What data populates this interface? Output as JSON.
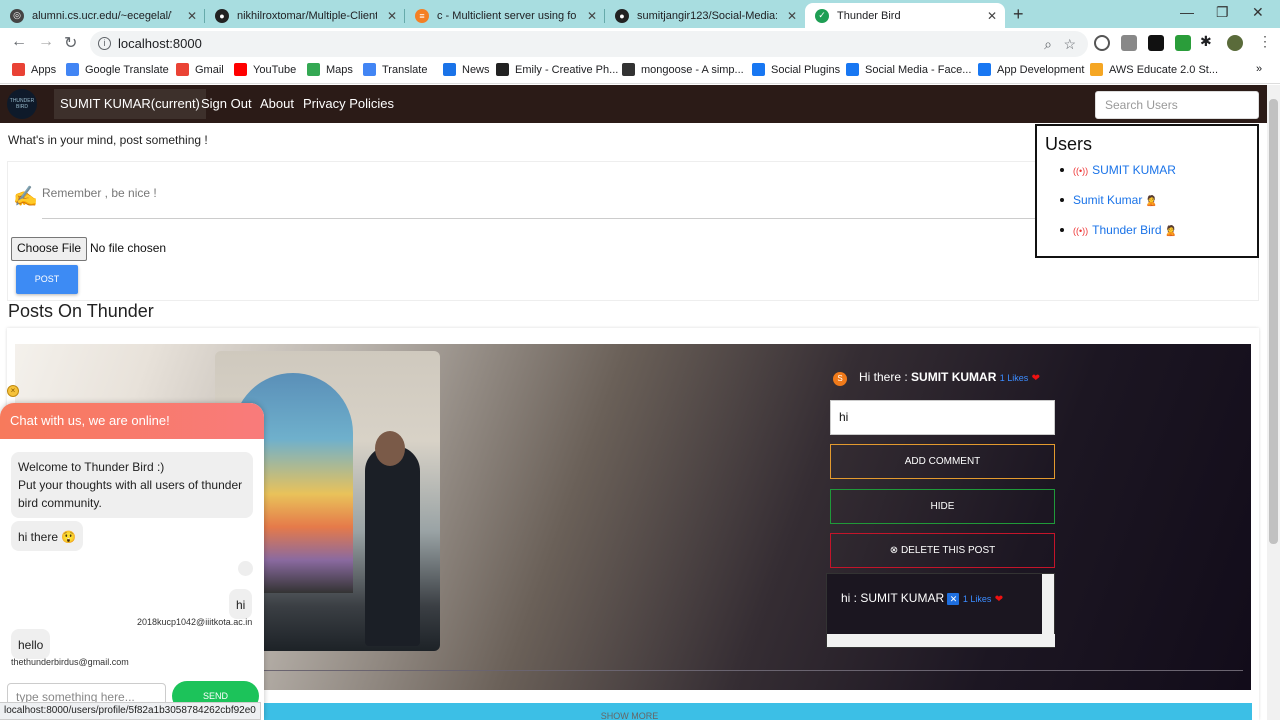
{
  "browser": {
    "tabs": [
      {
        "title": "alumni.cs.ucr.edu/~ecegelal/TAfi",
        "icon": "globe-icon"
      },
      {
        "title": "nikhilroxtomar/Multiple-Client-S",
        "icon": "github-icon"
      },
      {
        "title": "c - Multiclient server using fork()",
        "icon": "stackoverflow-icon"
      },
      {
        "title": "sumitjangir123/Social-Media: thi",
        "icon": "github-icon"
      },
      {
        "title": "Thunder Bird",
        "icon": "thunder-bird-icon",
        "active": true
      }
    ],
    "new_tab": "+",
    "url": "localhost:8000",
    "bookmarks": [
      {
        "label": "Apps",
        "color": "#e94235"
      },
      {
        "label": "Google Translate",
        "color": "#4285f4"
      },
      {
        "label": "Gmail",
        "color": "#ea4335"
      },
      {
        "label": "YouTube",
        "color": "#ff0000"
      },
      {
        "label": "Maps",
        "color": "#34a853"
      },
      {
        "label": "Translate",
        "color": "#4285f4"
      },
      {
        "label": "News",
        "color": "#1a73e8"
      },
      {
        "label": "Emily - Creative Ph...",
        "color": "#222222"
      },
      {
        "label": "mongoose - A simp...",
        "color": "#333333"
      },
      {
        "label": "Social Plugins",
        "color": "#1877f2"
      },
      {
        "label": "Social Media - Face...",
        "color": "#1877f2"
      },
      {
        "label": "App Development",
        "color": "#1877f2"
      },
      {
        "label": "AWS Educate 2.0 St...",
        "color": "#f5a623"
      }
    ],
    "bookmarks_more": "»",
    "status_url": "localhost:8000/users/profile/5f82a1b3058784262cbf92e0"
  },
  "site": {
    "logo_text": "THUNDER BIRD",
    "nav": {
      "current_user": "SUMIT KUMAR(current)",
      "sign_out": "Sign Out",
      "about": "About",
      "privacy": "Privacy Policies",
      "search_placeholder": "Search Users"
    },
    "composer": {
      "prompt": "What's in your mind, post something !",
      "placeholder": "Remember , be nice !",
      "choose_file": "Choose File",
      "no_file": "No file chosen",
      "post": "POST"
    },
    "posts_title": "Posts On Thunder",
    "post": {
      "avatar_letter": "S",
      "text": "Hi there : ",
      "author": "SUMIT KUMAR",
      "likes": "1 Likes",
      "comment_value": "hi",
      "add_comment": "ADD COMMENT",
      "hide": "HIDE",
      "delete": "DELETE THIS POST",
      "comments": [
        {
          "text": "hi : SUMIT KUMAR",
          "likes": "1 Likes"
        }
      ]
    },
    "show_more": "SHOW MORE",
    "users": {
      "title": "Users",
      "list": [
        {
          "name": "SUMIT KUMAR",
          "online": true
        },
        {
          "name": "Sumit Kumar",
          "online": false
        },
        {
          "name": "Thunder Bird",
          "online": true
        }
      ]
    }
  },
  "chat": {
    "header": "Chat with us, we are online!",
    "welcome": "Welcome to Thunder Bird :)\nPut your thoughts with all users of thunder bird community.",
    "messages": [
      {
        "text": "hi there 😲",
        "sender": ""
      },
      {
        "text": "hi",
        "sender": "2018kucp1042@iiitkota.ac.in"
      },
      {
        "text": "hello",
        "sender": "thethunderbirdus@gmail.com"
      }
    ],
    "input_placeholder": "type something here...",
    "send": "SEND"
  }
}
